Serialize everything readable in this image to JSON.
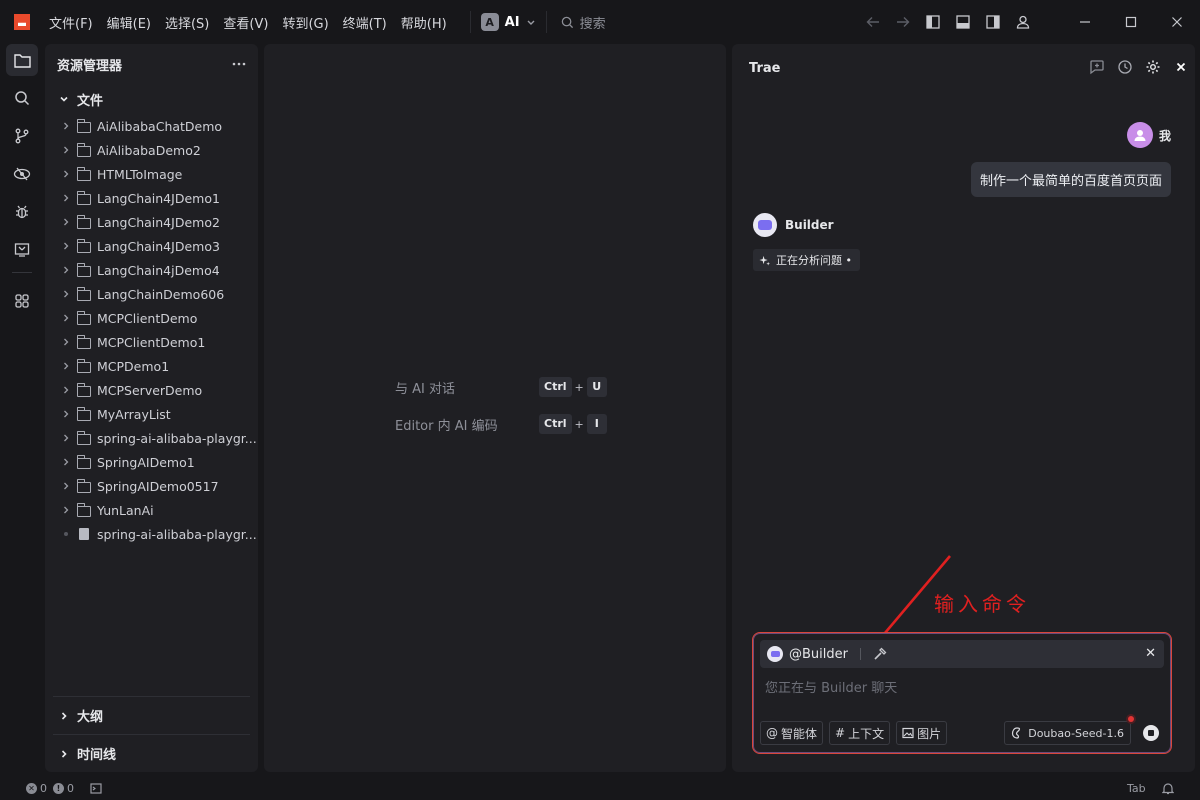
{
  "titlebar": {
    "menu": [
      "文件(F)",
      "编辑(E)",
      "选择(S)",
      "查看(V)",
      "转到(G)",
      "终端(T)",
      "帮助(H)"
    ],
    "ai_badge": "A",
    "ai_label": "AI",
    "search_label": "搜索"
  },
  "explorer": {
    "title": "资源管理器",
    "section_files": "文件",
    "items": [
      {
        "name": "AiAlibabaChatDemo",
        "type": "folder"
      },
      {
        "name": "AiAlibabaDemo2",
        "type": "folder"
      },
      {
        "name": "HTMLToImage",
        "type": "folder"
      },
      {
        "name": "LangChain4JDemo1",
        "type": "folder"
      },
      {
        "name": "LangChain4JDemo2",
        "type": "folder"
      },
      {
        "name": "LangChain4JDemo3",
        "type": "folder"
      },
      {
        "name": "LangChain4jDemo4",
        "type": "folder"
      },
      {
        "name": "LangChainDemo606",
        "type": "folder"
      },
      {
        "name": "MCPClientDemo",
        "type": "folder"
      },
      {
        "name": "MCPClientDemo1",
        "type": "folder"
      },
      {
        "name": "MCPDemo1",
        "type": "folder"
      },
      {
        "name": "MCPServerDemo",
        "type": "folder"
      },
      {
        "name": "MyArrayList",
        "type": "folder"
      },
      {
        "name": "spring-ai-alibaba-playgr...",
        "type": "folder"
      },
      {
        "name": "SpringAIDemo1",
        "type": "folder"
      },
      {
        "name": "SpringAIDemo0517",
        "type": "folder"
      },
      {
        "name": "YunLanAi",
        "type": "folder"
      },
      {
        "name": "spring-ai-alibaba-playgr...",
        "type": "file"
      }
    ],
    "section_outline": "大纲",
    "section_timeline": "时间线"
  },
  "editor": {
    "hints": [
      {
        "label": "与 AI 对话",
        "keys": [
          "Ctrl",
          "U"
        ]
      },
      {
        "label": "Editor 内 AI 编码",
        "keys": [
          "Ctrl",
          "I"
        ]
      }
    ],
    "plus": "+"
  },
  "chat": {
    "title": "Trae",
    "user_name": "我",
    "user_message": "制作一个最简单的百度首页页面",
    "bot_name": "Builder",
    "bot_status": "正在分析问题 •",
    "annotation": "输入命令",
    "input": {
      "mention": "@Builder",
      "placeholder": "您正在与 Builder 聊天",
      "chips": [
        {
          "icon": "@",
          "label": "智能体"
        },
        {
          "icon": "#",
          "label": "上下文"
        },
        {
          "icon": "image",
          "label": "图片"
        }
      ],
      "model": "Doubao-Seed-1.6"
    }
  },
  "statusbar": {
    "errors": "0",
    "warnings": "0",
    "tab_label": "Tab"
  }
}
